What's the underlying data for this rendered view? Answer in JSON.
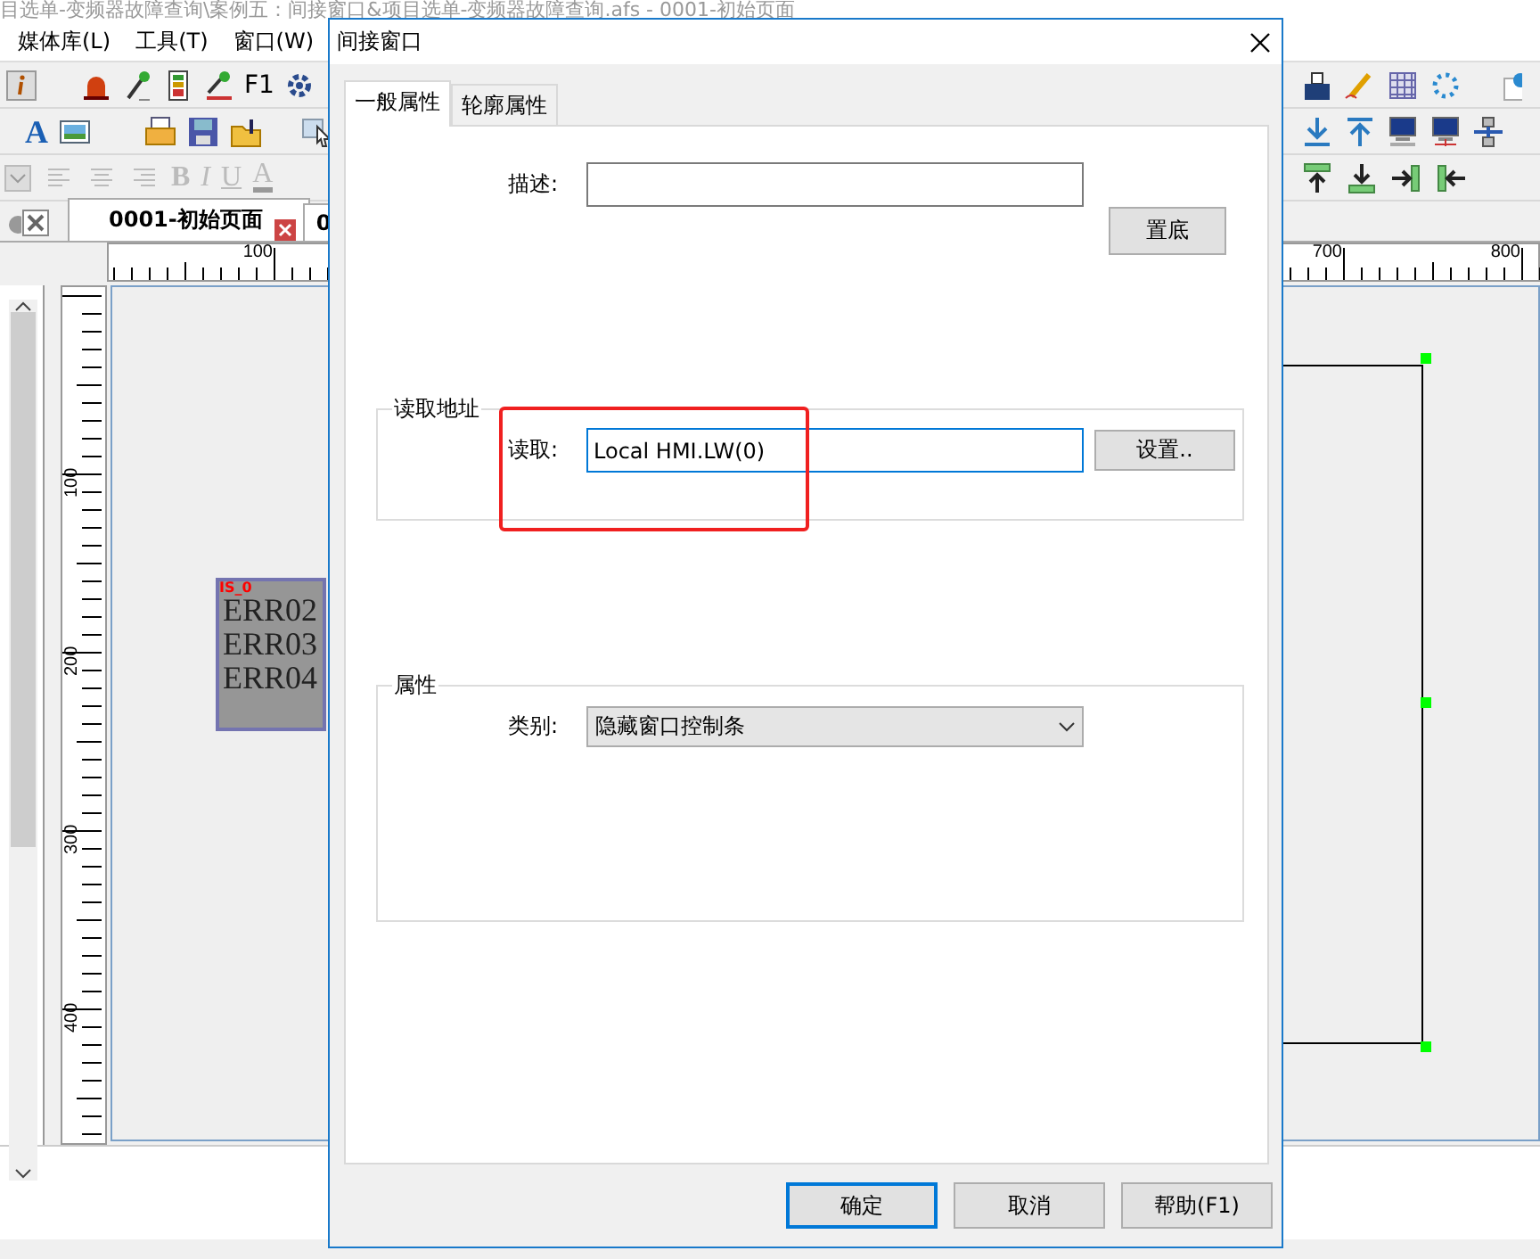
{
  "app_title": "目选单-变频器故障查询\\案例五：间接窗口&项目选单-变频器故障查询.afs - 0001-初始页面",
  "menu": [
    "媒体库(L)",
    "工具(T)",
    "窗口(W)"
  ],
  "toolbar": {
    "key_label": "F1",
    "font_label": "A",
    "format": [
      "B",
      "I",
      "U",
      "A"
    ]
  },
  "document_tabs": [
    {
      "label": "0001-初始页面",
      "selected": true
    },
    {
      "label": "0",
      "selected": false
    }
  ],
  "horizontal_ruler": [
    "100",
    "700",
    "800"
  ],
  "vertical_ruler": [
    "100",
    "200",
    "300",
    "400"
  ],
  "canvas": {
    "tag": "IS_0",
    "lines": [
      "ERR02",
      "ERR03",
      "ERR04"
    ]
  },
  "dialog": {
    "title": "间接窗口",
    "tabs": [
      {
        "label": "一般属性",
        "selected": true
      },
      {
        "label": "轮廓属性",
        "selected": false
      }
    ],
    "description_label": "描述:",
    "send_to_back_button": "置底",
    "read_address": {
      "legend": "读取地址",
      "label": "读取:",
      "value": "Local HMI.LW(0)",
      "focused": true,
      "button": "设置.."
    },
    "attributes": {
      "legend": "属性",
      "category_label": "类别:",
      "category_value": "隐藏窗口控制条"
    },
    "buttons": [
      {
        "label": "确定",
        "default": true
      },
      {
        "label": "取消",
        "default": false
      },
      {
        "label": "帮助(F1)",
        "default": false
      }
    ]
  }
}
